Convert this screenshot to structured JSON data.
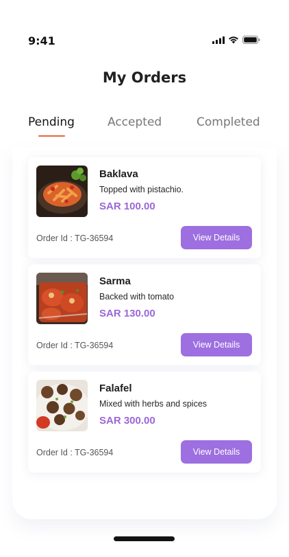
{
  "status_bar": {
    "time": "9:41",
    "icons": [
      "signal-icon",
      "wifi-icon",
      "battery-icon"
    ]
  },
  "header": {
    "title": "My Orders"
  },
  "tabs": [
    {
      "label": "Pending",
      "active": true
    },
    {
      "label": "Accepted",
      "active": false
    },
    {
      "label": "Completed",
      "active": false
    }
  ],
  "colors": {
    "accent": "#9d6fe0",
    "price": "#9a67d8",
    "tab_indicator": "#e8643b"
  },
  "orders": [
    {
      "name": "Baklava",
      "description": "Topped with pistachio.",
      "price": "SAR 100.00",
      "order_id": "Order Id : TG-36594",
      "button_label": "View Details",
      "image": "pasta-dish-image"
    },
    {
      "name": "Sarma",
      "description": "Backed with tomato",
      "price": "SAR 130.00",
      "order_id": "Order Id : TG-36594",
      "button_label": "View Details",
      "image": "stuffed-peppers-dish-image"
    },
    {
      "name": "Falafel",
      "description": "Mixed with herbs and spices",
      "price": "SAR 300.00",
      "order_id": "Order Id : TG-36594",
      "button_label": "View Details",
      "image": "meatballs-dish-image"
    }
  ]
}
